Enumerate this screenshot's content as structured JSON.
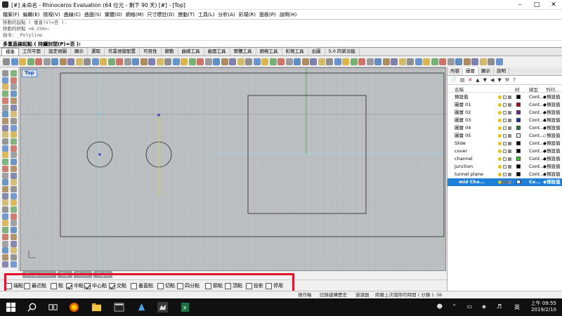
{
  "window": {
    "title": "[#] 未命名 - Rhinoceros Evaluation (64 位元 - 剩下 90 天) [#] - [Top]"
  },
  "menu": [
    "檔案(F)",
    "編輯(E)",
    "檢視(V)",
    "曲線(C)",
    "曲面(S)",
    "實體(O)",
    "網格(M)",
    "尺寸標註(D)",
    "變動(T)",
    "工具(L)",
    "分析(A)",
    "彩現(R)",
    "面板(P)",
    "說明(H)"
  ],
  "command": {
    "history": [
      "移動的起點 ( 垂直(V)=否 ):",
      "移動的終點 <6.250>:",
      "指令: _Polyline"
    ],
    "prompt": "多重直線起點 ( 持續封閉(P)=否 ):"
  },
  "tool_tabs": [
    "標準",
    "工作平面",
    "設定視圖",
    "顯示",
    "選取",
    "作業視窗配置",
    "可見性",
    "變動",
    "曲線工具",
    "曲面工具",
    "實體工具",
    "網格工具",
    "彩現工具",
    "出圖",
    "5.0 的新功能"
  ],
  "viewport": {
    "label": "Top",
    "tabs": [
      "Perspective",
      "Top",
      "Front",
      "Right"
    ]
  },
  "panel": {
    "tabs": [
      "內容",
      "圖層",
      "顯示",
      "說明"
    ],
    "active_tab": "圖層",
    "headers": {
      "name": "名稱",
      "material": "材",
      "linetype": "線型",
      "print": "列印..."
    },
    "layers": [
      {
        "name": "預設值",
        "color": "#000000",
        "linetype": "Cont...",
        "print": "◆預設值",
        "child": false,
        "selected": false
      },
      {
        "name": "圖層 01",
        "color": "#b3001e",
        "linetype": "Cont...",
        "print": "◆預設值",
        "child": false,
        "selected": false
      },
      {
        "name": "圖層 02",
        "color": "#7a1fa2",
        "linetype": "Cont...",
        "print": "◆預設值",
        "child": false,
        "selected": false
      },
      {
        "name": "圖層 03",
        "color": "#1d2fb0",
        "linetype": "Cont...",
        "print": "◆預設值",
        "child": false,
        "selected": false
      },
      {
        "name": "圖層 04",
        "color": "#1b8a2e",
        "linetype": "Cont...",
        "print": "◆預設值",
        "child": false,
        "selected": false
      },
      {
        "name": "圖層 05",
        "color": "#ffffff",
        "linetype": "Cont...",
        "print": "◇預設值",
        "child": false,
        "selected": false
      },
      {
        "name": "Slide",
        "color": "#000000",
        "linetype": "Cont...",
        "print": "◆預設值",
        "child": false,
        "selected": false
      },
      {
        "name": "cover",
        "color": "#000000",
        "linetype": "Cont...",
        "print": "◆預設值",
        "child": false,
        "selected": false
      },
      {
        "name": "channel",
        "color": "#2fd020",
        "linetype": "Cont...",
        "print": "◆預設值",
        "child": false,
        "selected": false
      },
      {
        "name": "junction",
        "color": "#000000",
        "linetype": "Cont...",
        "print": "◆預設值",
        "child": false,
        "selected": false
      },
      {
        "name": "tunnel plane",
        "color": "#000000",
        "linetype": "Cont...",
        "print": "◆預設值",
        "child": false,
        "selected": false
      },
      {
        "name": "mid Cha...",
        "color": "#ffffff",
        "linetype": "Co...",
        "print": "◆預設值",
        "child": true,
        "selected": true
      }
    ]
  },
  "osnap": [
    {
      "label": "端點",
      "checked": false
    },
    {
      "label": "最近點",
      "checked": false
    },
    {
      "label": "點",
      "checked": false
    },
    {
      "label": "中點",
      "checked": true
    },
    {
      "label": "中心點",
      "checked": true
    },
    {
      "label": "交點",
      "checked": true
    },
    {
      "label": "垂直點",
      "checked": false
    },
    {
      "label": "切點",
      "checked": false
    },
    {
      "label": "四分點",
      "checked": false
    },
    {
      "label": "節點",
      "checked": false
    },
    {
      "label": "頂點",
      "checked": false
    },
    {
      "label": "投影",
      "checked": false
    },
    {
      "label": "停用",
      "checked": false
    }
  ],
  "status": {
    "items": [
      "操作軸",
      "記錄建構歷史",
      "過濾器",
      "距離上次儲存的時間 ( 分鐘 ): 36"
    ]
  },
  "taskbar": {
    "ime": "英",
    "time": "上午 09:55",
    "date": "2019/2/10"
  }
}
